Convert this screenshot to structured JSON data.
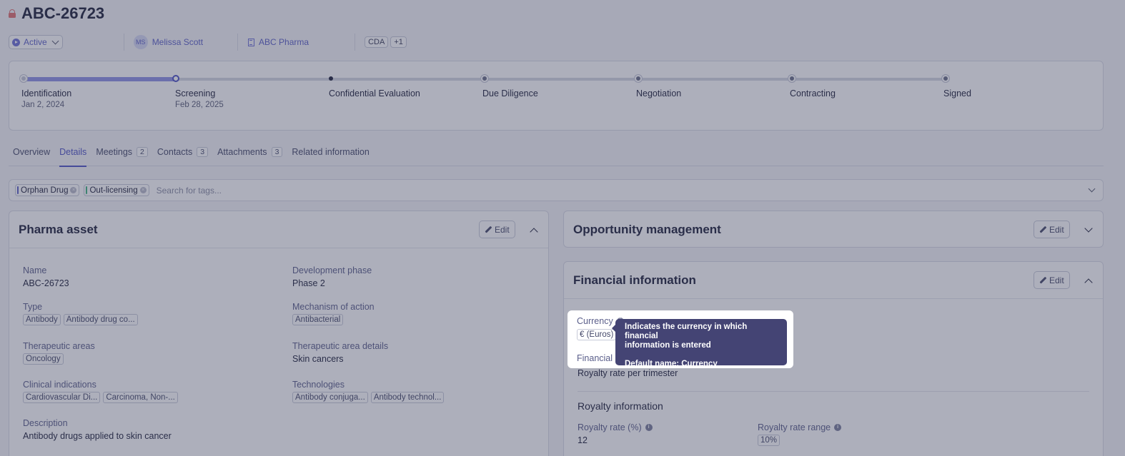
{
  "header": {
    "title": "ABC-26723"
  },
  "meta": {
    "status": "Active",
    "owner_initials": "MS",
    "owner_name": "Melissa Scott",
    "company": "ABC Pharma",
    "agreement": "CDA",
    "agreement_more": "+1"
  },
  "stages": [
    {
      "name": "Identification",
      "date": "Jan 2, 2024",
      "state": "done"
    },
    {
      "name": "Screening",
      "date": "Feb 28, 2025",
      "state": "current"
    },
    {
      "name": "Confidential Evaluation",
      "date": "",
      "state": "next"
    },
    {
      "name": "Due Diligence",
      "date": "",
      "state": "upcoming"
    },
    {
      "name": "Negotiation",
      "date": "",
      "state": "upcoming"
    },
    {
      "name": "Contracting",
      "date": "",
      "state": "upcoming"
    },
    {
      "name": "Signed",
      "date": "",
      "state": "upcoming"
    }
  ],
  "tabs": [
    {
      "label": "Overview",
      "count": ""
    },
    {
      "label": "Details",
      "count": "",
      "active": true
    },
    {
      "label": "Meetings",
      "count": "2"
    },
    {
      "label": "Contacts",
      "count": "3"
    },
    {
      "label": "Attachments",
      "count": "3"
    },
    {
      "label": "Related information",
      "count": ""
    }
  ],
  "tags": {
    "items": [
      {
        "label": "Orphan Drug",
        "color": "#5b5fc7"
      },
      {
        "label": "Out-licensing",
        "color": "#3fb27f"
      }
    ],
    "placeholder": "Search for tags..."
  },
  "pharma_asset": {
    "title": "Pharma asset",
    "edit_label": "Edit",
    "name_label": "Name",
    "name_value": "ABC-26723",
    "phase_label": "Development phase",
    "phase_value": "Phase 2",
    "type_label": "Type",
    "type_tags": [
      "Antibody",
      "Antibody drug co..."
    ],
    "moa_label": "Mechanism of action",
    "moa_tags": [
      "Antibacterial"
    ],
    "ta_label": "Therapeutic areas",
    "ta_tags": [
      "Oncology"
    ],
    "tad_label": "Therapeutic area details",
    "tad_value": "Skin cancers",
    "ci_label": "Clinical indications",
    "ci_tags": [
      "Cardiovascular Di...",
      "Carcinoma, Non-..."
    ],
    "tech_label": "Technologies",
    "tech_tags": [
      "Antibody conjuga...",
      "Antibody technol..."
    ],
    "desc_label": "Description",
    "desc_value": "Antibody drugs applied to skin cancer"
  },
  "opportunity": {
    "title": "Opportunity management",
    "edit_label": "Edit"
  },
  "financial": {
    "title": "Financial information",
    "edit_label": "Edit",
    "currency_label": "Currency",
    "currency_value": "€ (Euros)",
    "fin_label": "Financial",
    "fin_value": "Royalty rate per trimester",
    "royalty_title": "Royalty information",
    "rate_label": "Royalty rate (%)",
    "rate_value": "12",
    "range_label": "Royalty rate range",
    "range_value": "10%"
  },
  "tooltip": {
    "line1": "Indicates the currency in which financial",
    "line2": "information is entered",
    "default_name": "Default name: Currency"
  },
  "colors": {
    "accent": "#4d51c4",
    "overlay": "#3c405c",
    "tooltip": "#444474"
  }
}
